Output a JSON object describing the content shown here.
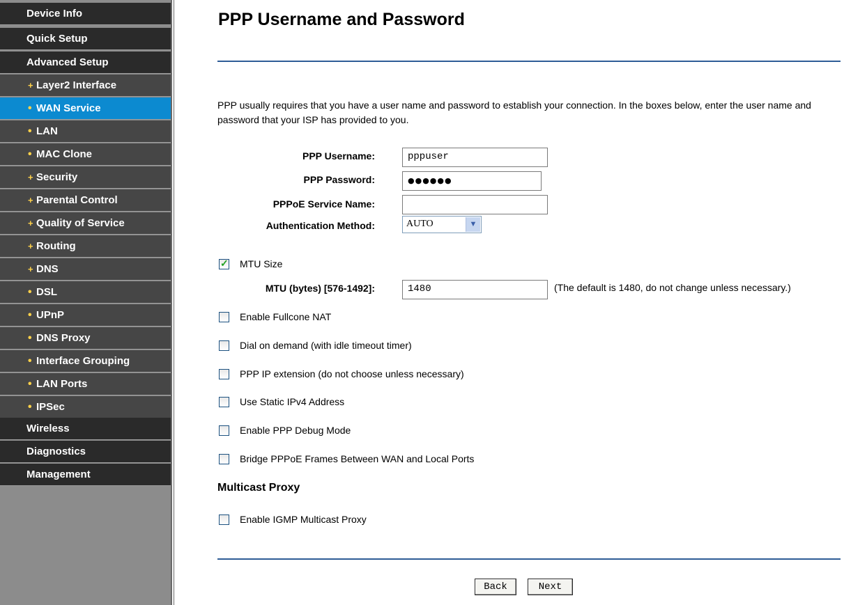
{
  "sidebar": {
    "items": [
      {
        "label": "Device Info",
        "kind": "main"
      },
      {
        "label": "Quick Setup",
        "kind": "main"
      },
      {
        "label": "Advanced Setup",
        "kind": "main"
      },
      {
        "label": "Layer2 Interface",
        "kind": "sub",
        "bullet": "+"
      },
      {
        "label": "WAN Service",
        "kind": "sub",
        "bullet": "•",
        "active": true
      },
      {
        "label": "LAN",
        "kind": "sub",
        "bullet": "•"
      },
      {
        "label": "MAC Clone",
        "kind": "sub",
        "bullet": "•"
      },
      {
        "label": "Security",
        "kind": "sub",
        "bullet": "+"
      },
      {
        "label": "Parental Control",
        "kind": "sub",
        "bullet": "+"
      },
      {
        "label": "Quality of Service",
        "kind": "sub",
        "bullet": "+"
      },
      {
        "label": "Routing",
        "kind": "sub",
        "bullet": "+"
      },
      {
        "label": "DNS",
        "kind": "sub",
        "bullet": "+"
      },
      {
        "label": "DSL",
        "kind": "sub",
        "bullet": "•"
      },
      {
        "label": "UPnP",
        "kind": "sub",
        "bullet": "•"
      },
      {
        "label": "DNS Proxy",
        "kind": "sub",
        "bullet": "•"
      },
      {
        "label": "Interface Grouping",
        "kind": "sub",
        "bullet": "•"
      },
      {
        "label": "LAN Ports",
        "kind": "sub",
        "bullet": "•"
      },
      {
        "label": "IPSec",
        "kind": "sub",
        "bullet": "•"
      },
      {
        "label": "Wireless",
        "kind": "main"
      },
      {
        "label": "Diagnostics",
        "kind": "main"
      },
      {
        "label": "Management",
        "kind": "main"
      }
    ]
  },
  "page": {
    "title": "PPP Username and Password",
    "intro": "PPP usually requires that you have a user name and password to establish your connection. In the boxes below, enter the user name and password that your ISP has provided to you."
  },
  "form": {
    "username_label": "PPP Username:",
    "username_value": "pppuser",
    "password_label": "PPP Password:",
    "password_value": "●●●●●●",
    "service_name_label": "PPPoE Service Name:",
    "service_name_value": "",
    "auth_label": "Authentication Method:",
    "auth_value": "AUTO",
    "mtu_checkbox_label": "MTU Size",
    "mtu_checked": true,
    "mtu_bytes_label": "MTU (bytes) [576-1492]:",
    "mtu_value": "1480",
    "mtu_hint": "(The default is 1480, do not change unless necessary.)",
    "options": [
      {
        "label": "Enable Fullcone NAT",
        "checked": false
      },
      {
        "label": "Dial on demand (with idle timeout timer)",
        "checked": false
      },
      {
        "label": "PPP IP extension (do not choose unless necessary)",
        "checked": false
      },
      {
        "label": "Use Static IPv4 Address",
        "checked": false
      },
      {
        "label": "Enable PPP Debug Mode",
        "checked": false
      },
      {
        "label": "Bridge PPPoE Frames Between WAN and Local Ports",
        "checked": false
      }
    ],
    "multicast_heading": "Multicast Proxy",
    "igmp_label": "Enable IGMP Multicast Proxy",
    "igmp_checked": false
  },
  "buttons": {
    "back": "Back",
    "next": "Next"
  },
  "colors": {
    "sidebar_main": "#2a2a2a",
    "sidebar_sub": "#464646",
    "sidebar_active": "#0c8ad0",
    "divider": "#2e5c96"
  }
}
